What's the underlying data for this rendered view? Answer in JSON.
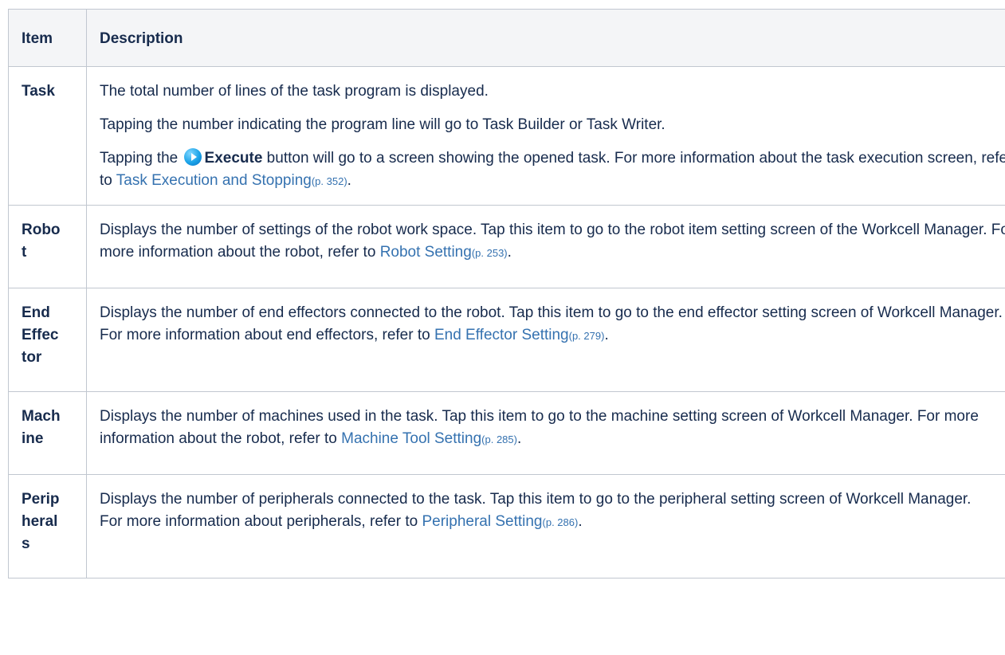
{
  "table": {
    "headers": {
      "item": "Item",
      "description": "Description"
    },
    "rows": [
      {
        "item": "Task",
        "p1": "The total number of lines of the task program is displayed.",
        "p2": "Tapping the number indicating the program line will go to Task Builder or Task Writer.",
        "p3_before": "Tapping the",
        "p3_icon": "play-circle-icon",
        "p3_bold": "Execute",
        "p3_after": " button will go to a screen showing the opened task. For more information about the task execution screen, refer to ",
        "link": "Task Execution and Stopping",
        "page_ref": "(p. 352)",
        "end": "."
      },
      {
        "item": "Robo\nt",
        "text": "Displays the number of settings of the robot work space. Tap this item to go to the robot item setting screen of the Workcell Manager. For more information about the robot, refer to ",
        "link": "Robot Setting",
        "page_ref": "(p. 253)",
        "end": "."
      },
      {
        "item": "End\nEffec\ntor",
        "text": "Displays the number of end effectors connected to the robot. Tap this item to go to the end effector setting screen of Workcell Manager. For more information about end effectors, refer to ",
        "link": "End Effector Setting",
        "page_ref": "(p. 279)",
        "end": "."
      },
      {
        "item": "Mach\nine",
        "text": "Displays the number of machines used in the task. Tap this item to go to the machine setting screen of Workcell Manager. For more information about the robot, refer to ",
        "link": "Machine Tool Setting",
        "page_ref": "(p. 285)",
        "end": "."
      },
      {
        "item": "Perip\nheral\ns",
        "text": "Displays the number of peripherals connected to the task. Tap this item to go to the peripheral setting screen of Workcell Manager.\nFor more information about peripherals, refer to ",
        "link": "Peripheral Setting",
        "page_ref": "(p. 286)",
        "end": "."
      }
    ]
  },
  "colors": {
    "text": "#172b4d",
    "link": "#3572b0",
    "header_bg": "#f4f5f7",
    "border": "#c1c7d0"
  }
}
